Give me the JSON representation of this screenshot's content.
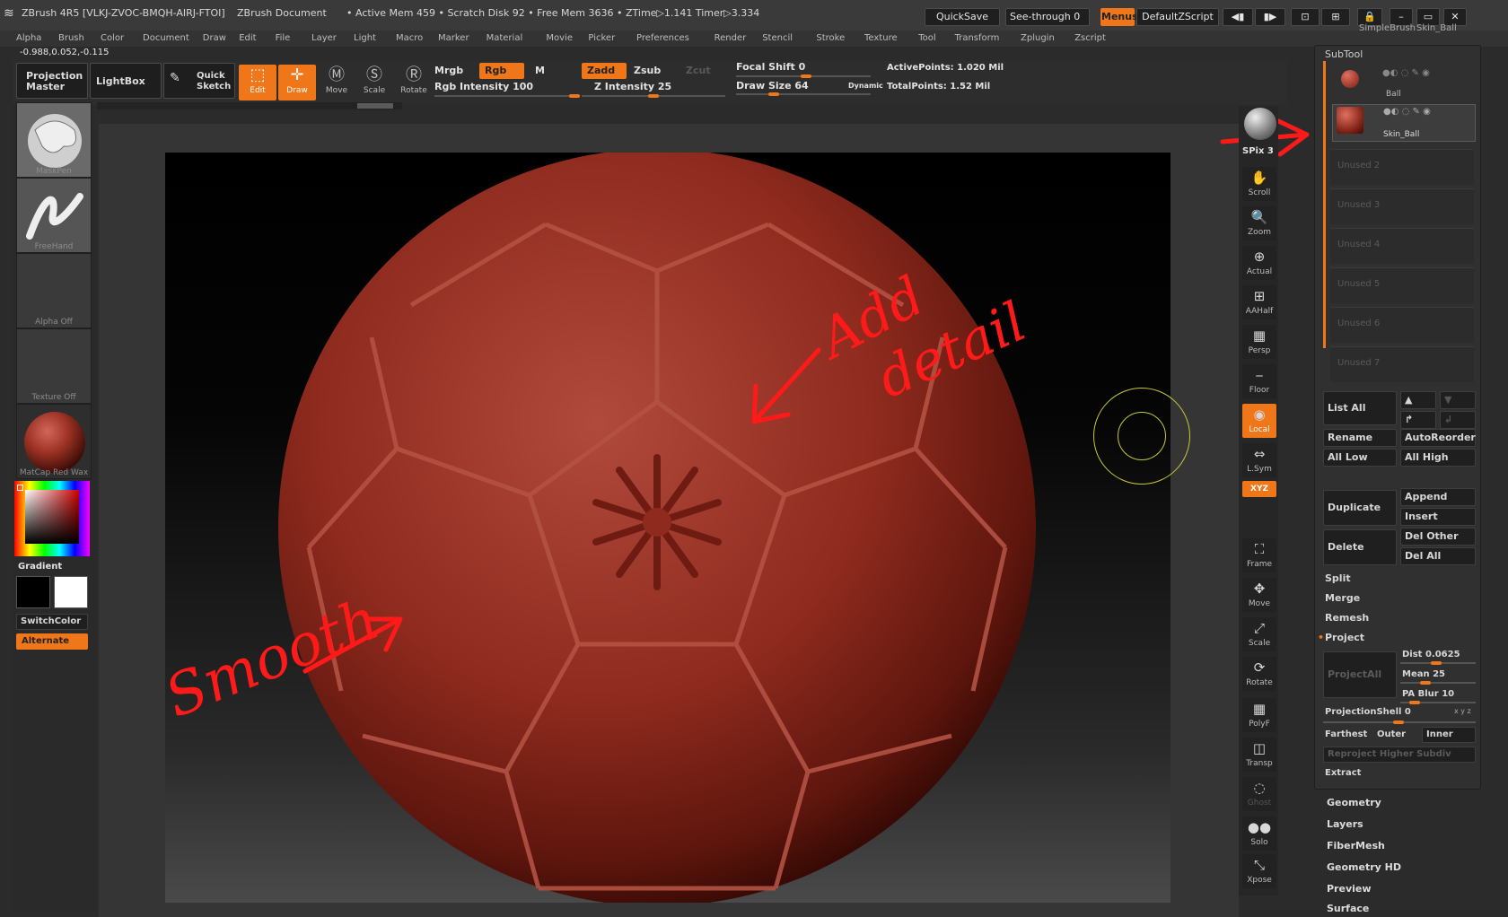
{
  "title_bar": {
    "app": "ZBrush 4R5 [VLKJ-ZVOC-BMQH-AIRJ-FTOI]",
    "document": "ZBrush Document",
    "stats": "• Active Mem 459 • Scratch Disk 92 • Free Mem 3636 • ZTime▷1.141 Timer▷3.334",
    "quicksave": "QuickSave",
    "see_through": "See-through  0",
    "see_through_level": 0,
    "menus": "Menus",
    "script": "DefaultZScript"
  },
  "menu": [
    "Alpha",
    "Brush",
    "Color",
    "Document",
    "Draw",
    "Edit",
    "File",
    "Layer",
    "Light",
    "Macro",
    "Marker",
    "Material",
    "Movie",
    "Picker",
    "Preferences",
    "Render",
    "Stencil",
    "Stroke",
    "Texture",
    "Tool",
    "Transform",
    "Zplugin",
    "Zscript"
  ],
  "coord_readout": "-0.988,0.052,-0.115",
  "shelf": {
    "projection_master": "Projection Master",
    "lightbox": "LightBox",
    "quick_sketch": "Quick Sketch",
    "tools": [
      "Edit",
      "Draw",
      "Move",
      "Scale",
      "Rotate"
    ],
    "mrgb": "Mrgb",
    "rgb": "Rgb",
    "m": "M",
    "rgb_intensity": "Rgb Intensity 100",
    "rgb_intensity_value": 100,
    "zadd": "Zadd",
    "zsub": "Zsub",
    "zcut": "Zcut",
    "z_intensity": "Z Intensity 25",
    "z_intensity_value": 25,
    "focal_shift": "Focal Shift 0",
    "focal_shift_value": 0,
    "draw_size": "Draw Size 64",
    "draw_size_value": 64,
    "dynamic": "Dynamic",
    "active_points": "ActivePoints: 1.020 Mil",
    "total_points": "TotalPoints: 1.52 Mil"
  },
  "left_tray": {
    "brush": "MaskPen",
    "stroke": "FreeHand",
    "alpha": "Alpha  Off",
    "texture": "Texture  Off",
    "material": "MatCap  Red  Wax",
    "gradient": "Gradient",
    "switch_color": "SwitchColor",
    "alternate": "Alternate"
  },
  "annotations": {
    "add_detail_1": "Add",
    "add_detail_2": "detail",
    "smooth": "Smooth"
  },
  "right_tray": {
    "spix": "SPix 3",
    "buttons": [
      "Scroll",
      "Zoom",
      "Actual",
      "AAHalf",
      "Persp",
      "Floor",
      "Local",
      "L.Sym",
      "XYZ",
      "Frame",
      "Move",
      "Scale",
      "Rotate",
      "PolyF",
      "Transp",
      "Ghost",
      "Solo",
      "Xpose"
    ]
  },
  "subtool": {
    "top_labels": [
      "SimpleBrush",
      "Skin_Ball"
    ],
    "header": "SubTool",
    "items": [
      "Ball",
      "Skin_Ball"
    ],
    "unused": [
      "Unused  2",
      "Unused  3",
      "Unused  4",
      "Unused  5",
      "Unused  6",
      "Unused  7"
    ],
    "list_all": "List  All",
    "rename": "Rename",
    "auto_reorder": "AutoReorder",
    "all_low": "All  Low",
    "all_high": "All  High",
    "duplicate": "Duplicate",
    "append": "Append",
    "insert": "Insert",
    "delete": "Delete",
    "del_other": "Del  Other",
    "del_all": "Del  All",
    "split": "Split",
    "merge": "Merge",
    "remesh": "Remesh",
    "project": "Project",
    "project_all": "ProjectAll",
    "dist": "Dist 0.0625",
    "dist_value": 0.0625,
    "mean": "Mean 25",
    "mean_value": 25,
    "pa_blur": "PA  Blur 10",
    "pa_blur_value": 10,
    "projection_shell": "ProjectionShell 0",
    "projection_shell_value": 0,
    "xyz_small": "x y z",
    "farthest": "Farthest",
    "outer": "Outer",
    "inner": "Inner",
    "reproject": "Reproject  Higher  Subdiv",
    "extract": "Extract"
  },
  "tool_menu": [
    "Geometry",
    "Layers",
    "FiberMesh",
    "Geometry HD",
    "Preview",
    "Surface"
  ],
  "colors": {
    "accent": "#f0761a",
    "annotation": "#ff1a1a",
    "ball": "#8e2a1e",
    "cursor": "#c8c83a"
  }
}
